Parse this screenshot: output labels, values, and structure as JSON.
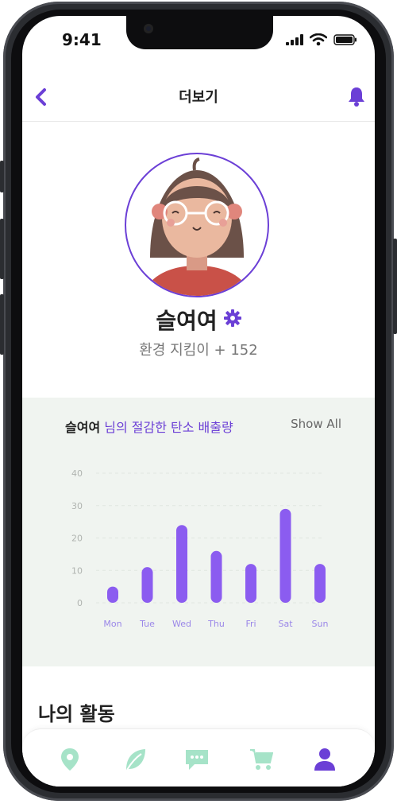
{
  "status": {
    "time": "9:41"
  },
  "header": {
    "title": "더보기"
  },
  "profile": {
    "name": "슬여여",
    "subtitle": "환경 지킴이 + 152"
  },
  "stats": {
    "title_name": "슬여여",
    "title_rest": " 님의 절감한 탄소 배출량",
    "show_all": "Show All"
  },
  "chart_data": {
    "type": "bar",
    "categories": [
      "Mon",
      "Tue",
      "Wed",
      "Thu",
      "Fri",
      "Sat",
      "Sun"
    ],
    "values": [
      5,
      11,
      24,
      16,
      12,
      29,
      12
    ],
    "yticks": [
      "40",
      "30",
      "20",
      "10",
      "0"
    ],
    "ylim": [
      0,
      40
    ],
    "grid": true,
    "bar_color": "#8b5cf0"
  },
  "activity": {
    "title": "나의 활동"
  },
  "tabs": [
    {
      "icon": "map-pin-icon",
      "active": false
    },
    {
      "icon": "leaf-icon",
      "active": false
    },
    {
      "icon": "chat-icon",
      "active": false
    },
    {
      "icon": "cart-icon",
      "active": false
    },
    {
      "icon": "user-icon",
      "active": true
    }
  ],
  "colors": {
    "accent": "#6b3fd6",
    "tab_inactive": "#a6e3c8",
    "panel_bg": "#f0f4f0"
  }
}
